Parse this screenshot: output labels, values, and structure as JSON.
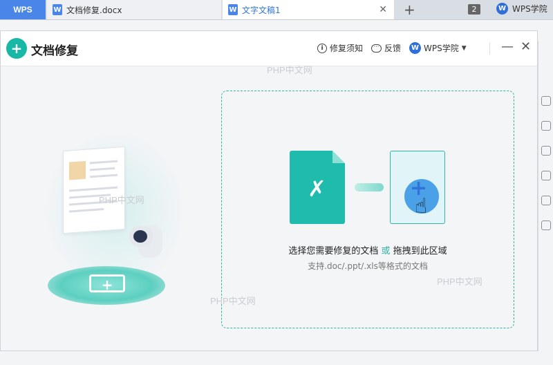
{
  "tabs": {
    "wps_label": "WPS",
    "doc1_label": "文档修复.docx",
    "doc2_label": "文字文稿1",
    "tab_count": "2",
    "academy_label": "WPS学院"
  },
  "dialog": {
    "title": "文档修复",
    "header": {
      "notice_label": "修复须知",
      "feedback_label": "反馈",
      "academy_label": "WPS学院"
    },
    "dropzone": {
      "instruction_part1": "选择您需要修复的文档",
      "instruction_or": "或",
      "instruction_part2": "拖拽到此区域",
      "formats": "支持.doc/.ppt/.xls等格式的文档"
    }
  },
  "watermark_text": "PHP中文网",
  "colors": {
    "accent": "#17b9a6",
    "wps_blue": "#4a86e8",
    "link_blue": "#2f73d9"
  },
  "icons": [
    "close-icon",
    "plus-icon",
    "info-icon",
    "feedback-icon",
    "wps-logo-icon",
    "minimize-icon",
    "wrench-icon",
    "hand-cursor-icon"
  ]
}
